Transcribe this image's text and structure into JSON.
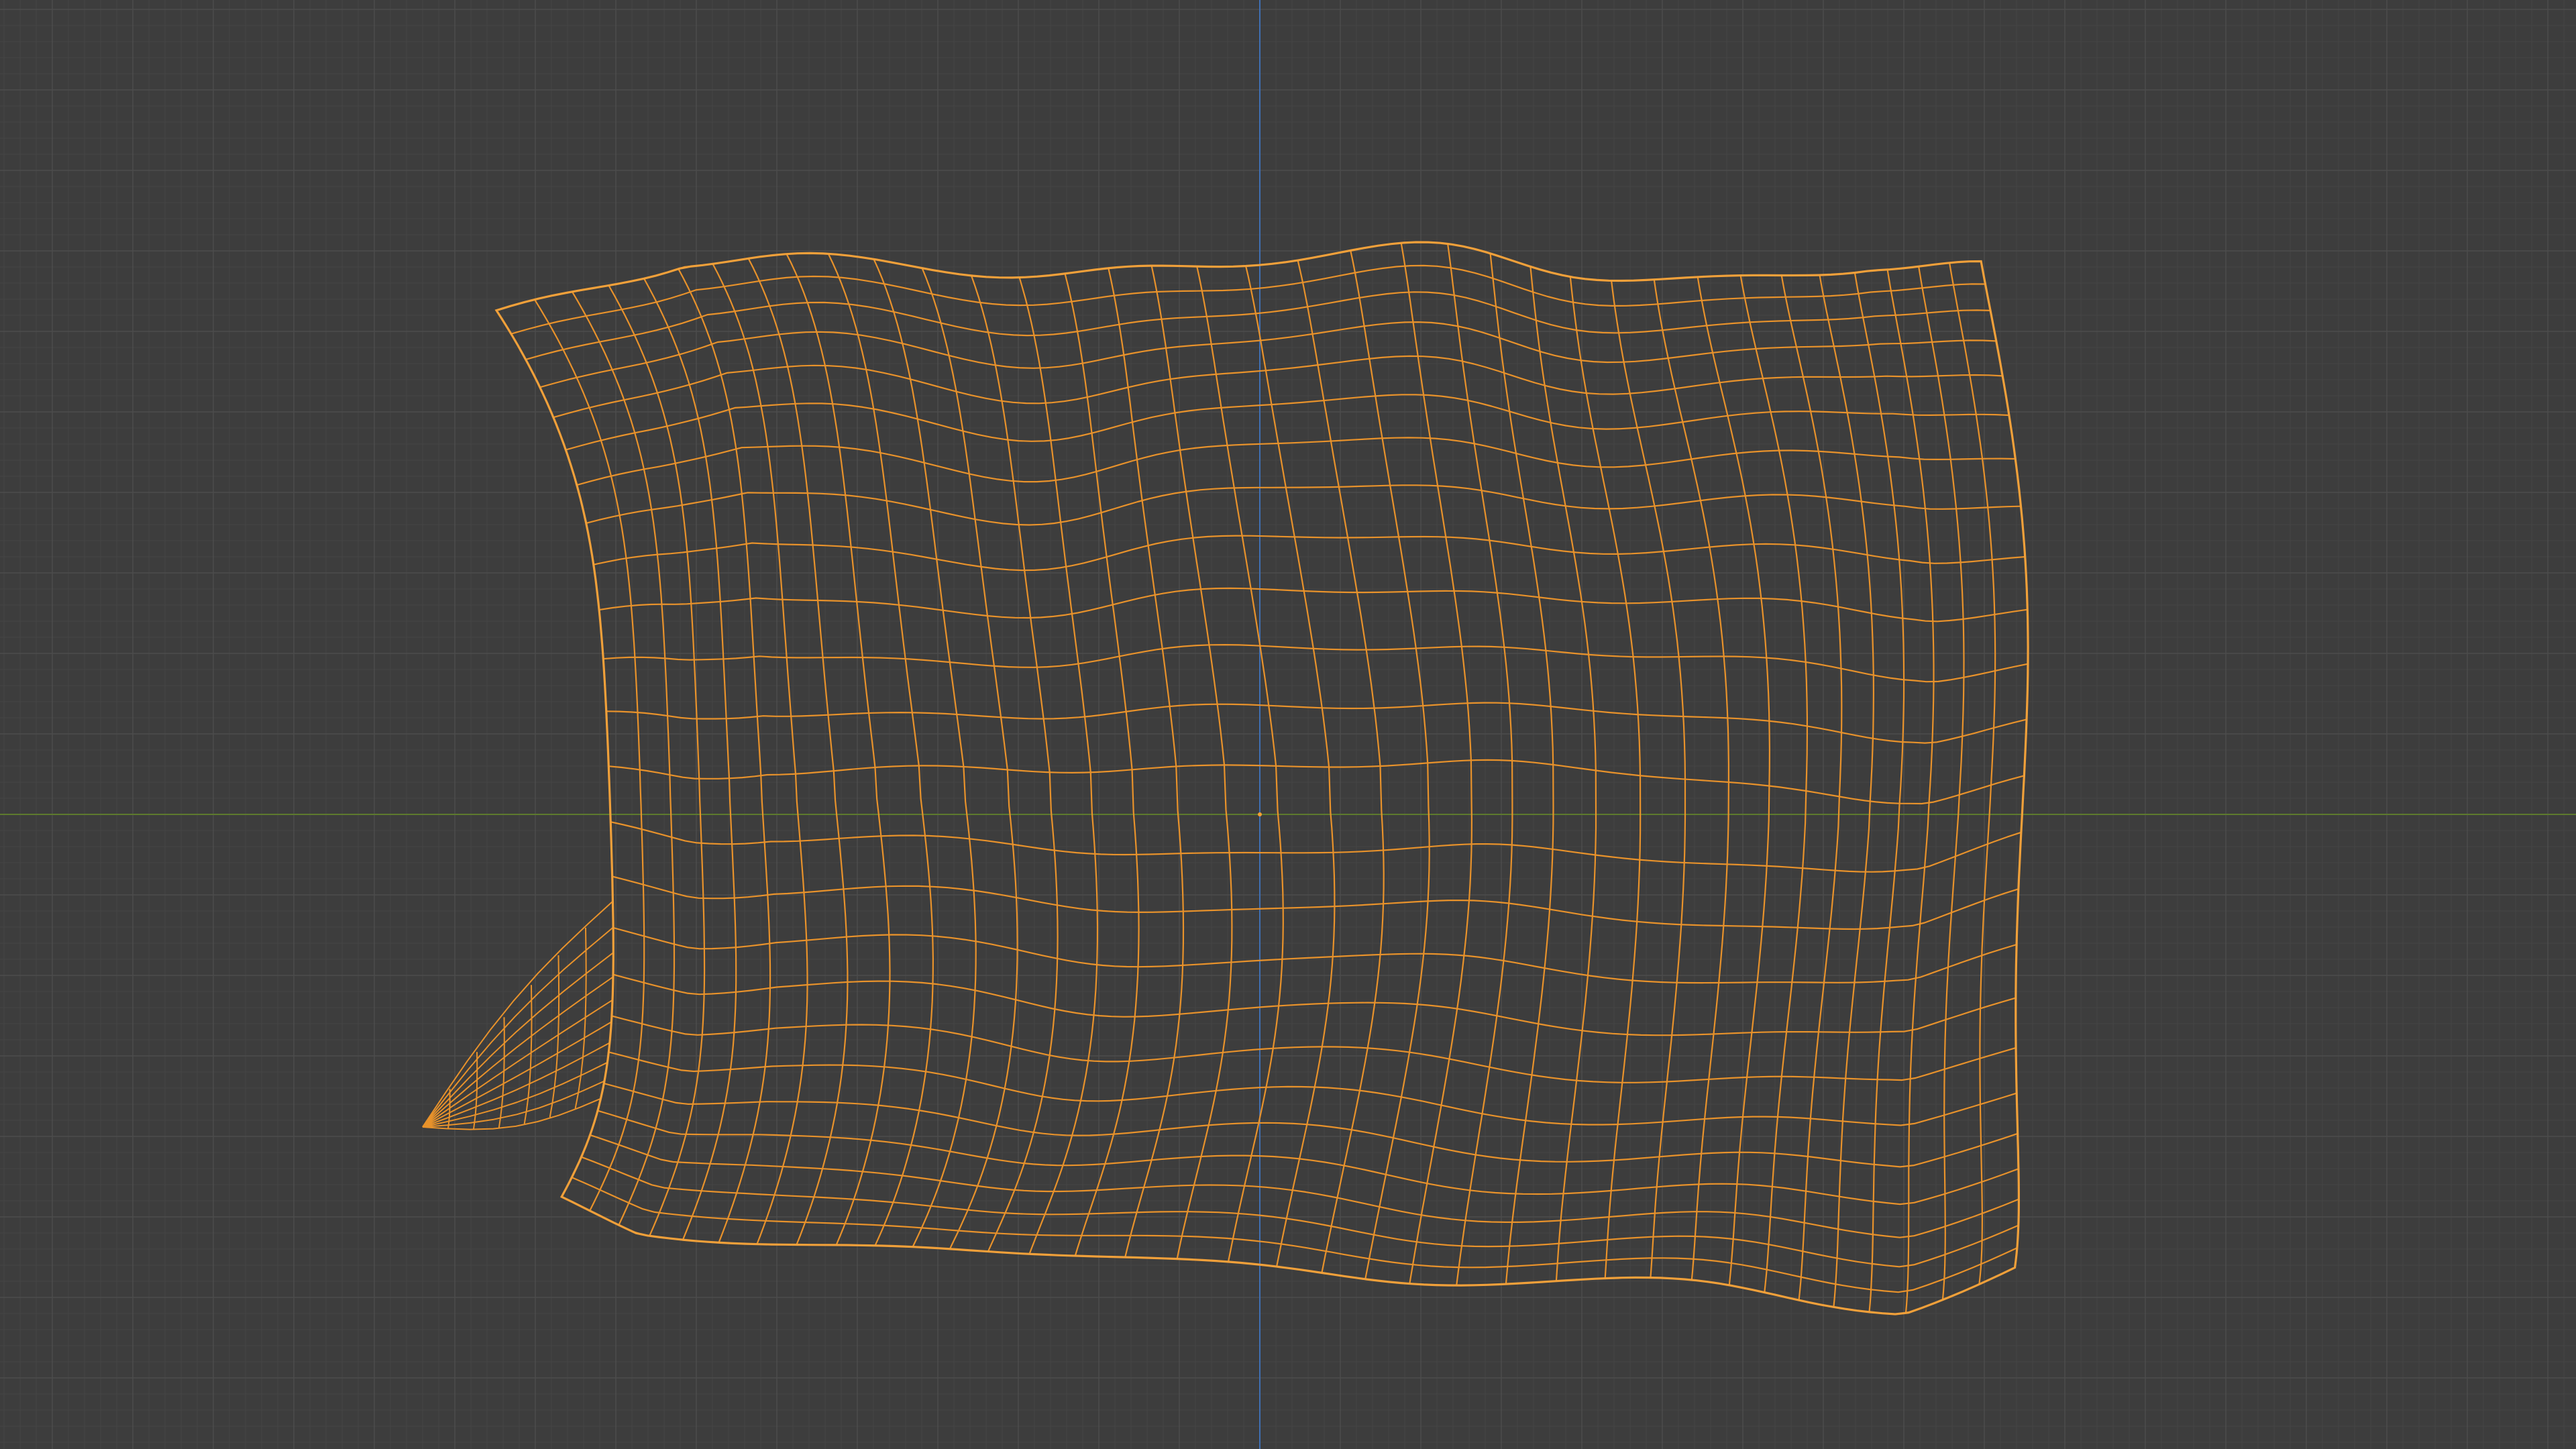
{
  "viewport": {
    "background": "#3d3d3d",
    "grid_minor_color": "#454545",
    "grid_major_color": "#4c4c4c",
    "axis_x_color": "#5d7a2d",
    "axis_y_color": "#3f6fb3",
    "wire_color": "#e8922b",
    "wire_outline_color": "#f0a03a",
    "origin_dot_color": "#f5a031"
  },
  "object": {
    "shading": "wireframe",
    "selected": true
  }
}
